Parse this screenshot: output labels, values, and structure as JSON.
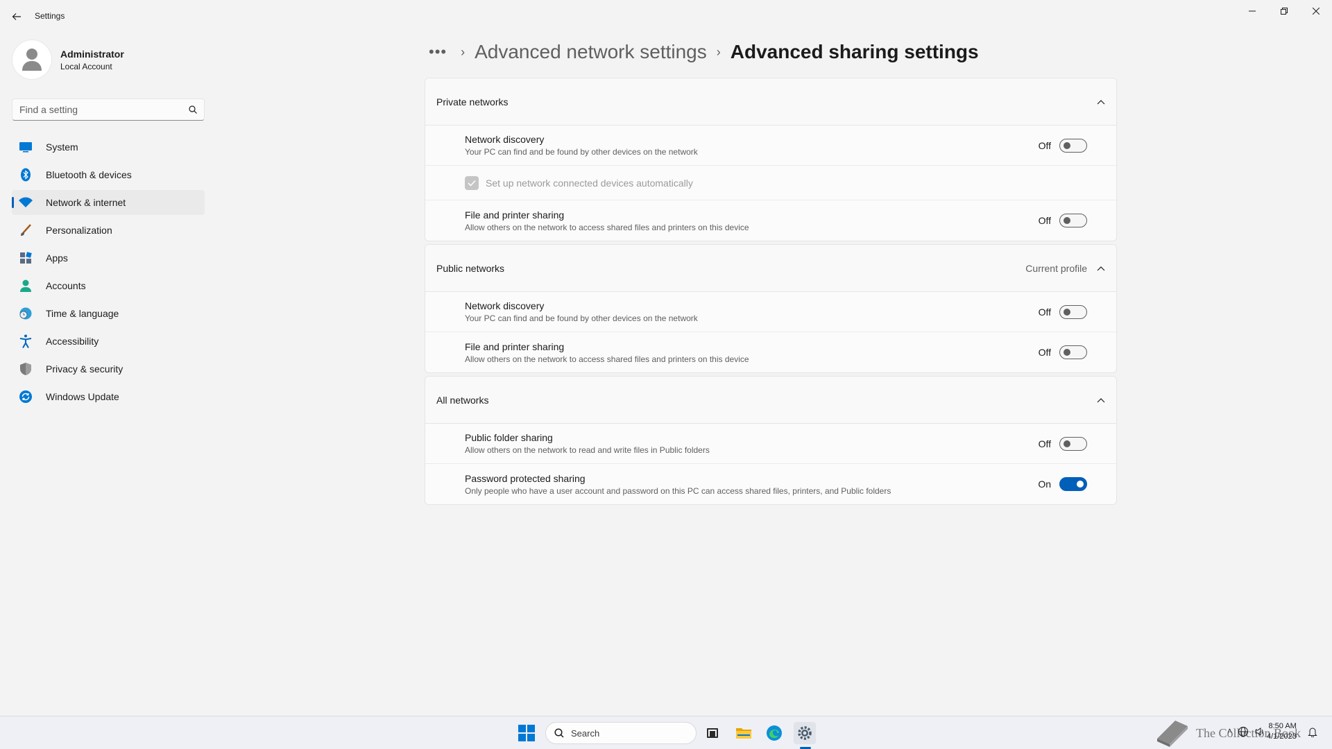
{
  "window": {
    "app_title": "Settings",
    "controls": [
      "minimize",
      "restore",
      "close"
    ]
  },
  "profile": {
    "name": "Administrator",
    "account_type": "Local Account"
  },
  "search": {
    "placeholder": "Find a setting"
  },
  "sidebar": {
    "items": [
      {
        "label": "System",
        "icon": "monitor-icon",
        "active": false
      },
      {
        "label": "Bluetooth & devices",
        "icon": "bluetooth-icon",
        "active": false
      },
      {
        "label": "Network & internet",
        "icon": "wifi-icon",
        "active": true
      },
      {
        "label": "Personalization",
        "icon": "brush-icon",
        "active": false
      },
      {
        "label": "Apps",
        "icon": "apps-icon",
        "active": false
      },
      {
        "label": "Accounts",
        "icon": "person-icon",
        "active": false
      },
      {
        "label": "Time & language",
        "icon": "globe-clock-icon",
        "active": false
      },
      {
        "label": "Accessibility",
        "icon": "accessibility-icon",
        "active": false
      },
      {
        "label": "Privacy & security",
        "icon": "shield-icon",
        "active": false
      },
      {
        "label": "Windows Update",
        "icon": "update-icon",
        "active": false
      }
    ]
  },
  "breadcrumb": {
    "more": "•••",
    "parent": "Advanced network settings",
    "current": "Advanced sharing settings"
  },
  "sections": {
    "private": {
      "title": "Private networks",
      "network_discovery": {
        "title": "Network discovery",
        "desc": "Your PC can find and be found by other devices on the network",
        "state": "Off"
      },
      "auto_setup": {
        "label": "Set up network connected devices automatically",
        "checked": true,
        "disabled": true
      },
      "file_printer": {
        "title": "File and printer sharing",
        "desc": "Allow others on the network to access shared files and printers on this device",
        "state": "Off"
      }
    },
    "public": {
      "title": "Public networks",
      "tag": "Current profile",
      "network_discovery": {
        "title": "Network discovery",
        "desc": "Your PC can find and be found by other devices on the network",
        "state": "Off"
      },
      "file_printer": {
        "title": "File and printer sharing",
        "desc": "Allow others on the network to access shared files and printers on this device",
        "state": "Off"
      }
    },
    "all": {
      "title": "All networks",
      "public_folder": {
        "title": "Public folder sharing",
        "desc": "Allow others on the network to read and write files in Public folders",
        "state": "Off"
      },
      "password_protected": {
        "title": "Password protected sharing",
        "desc": "Only people who have a user account and password on this PC can access shared files, printers, and Public folders",
        "state": "On"
      }
    }
  },
  "taskbar": {
    "search_label": "Search",
    "apps": [
      "windows-start-icon",
      "task-view-icon",
      "file-explorer-icon",
      "edge-icon",
      "settings-icon"
    ],
    "watermark": "The Collection Book",
    "time": "8:50 AM",
    "date": "4/1/2023"
  },
  "colors": {
    "accent": "#005fb8",
    "background": "#f3f3f3",
    "card": "#fbfbfb"
  }
}
